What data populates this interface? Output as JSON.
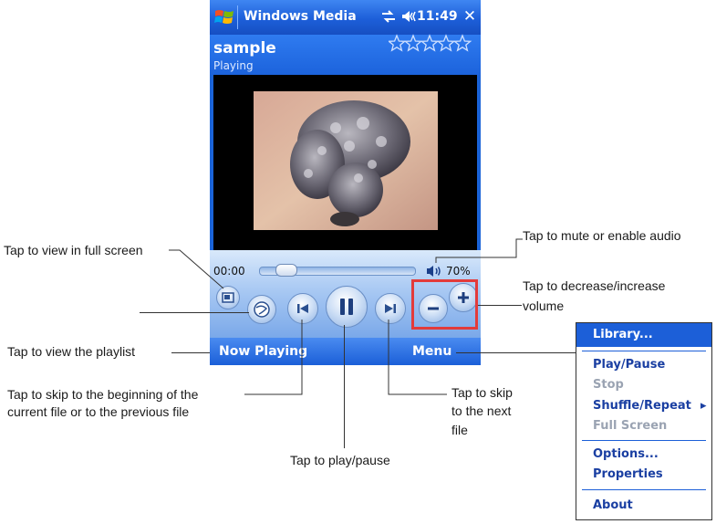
{
  "titlebar": {
    "app_title": "Windows Media",
    "clock": "11:49",
    "close": "✕"
  },
  "track": {
    "title": "sample",
    "status": "Playing",
    "rating": "☆☆☆☆☆"
  },
  "playback": {
    "elapsed": "00:00",
    "progress": 0.05,
    "volume": "70%"
  },
  "menubar": {
    "now_playing": "Now Playing",
    "menu": "Menu"
  },
  "annotations": {
    "fullscreen": "Tap to view in full screen",
    "mute": "Tap to mute or enable audio",
    "volume_1": "Tap to decrease/increase",
    "volume_2": "volume",
    "playlist": "Tap to view the playlist",
    "skip_prev_1": "Tap to skip to the beginning of the",
    "skip_prev_2": "current file or to the previous file",
    "skip_next_1": "Tap to skip",
    "skip_next_2": "to the next",
    "skip_next_3": "file",
    "play_pause": "Tap to play/pause"
  },
  "context_menu": {
    "header": "Library...",
    "items": [
      {
        "label": "Play/Pause",
        "enabled": true
      },
      {
        "label": "Stop",
        "enabled": false
      },
      {
        "label": "Shuffle/Repeat",
        "enabled": true,
        "submenu": "▸"
      },
      {
        "label": "Full Screen",
        "enabled": false
      },
      {
        "label": "Options...",
        "enabled": true
      },
      {
        "label": "Properties",
        "enabled": true
      },
      {
        "label": "About",
        "enabled": true
      }
    ]
  },
  "icons": {
    "start": "windows-flag-icon",
    "sync": "connectivity-icon",
    "speaker": "speaker-icon",
    "close": "close-icon",
    "fullscreen": "fullscreen-icon",
    "playlist": "playlist-globe-icon",
    "prev": "skip-previous-icon",
    "play": "pause-icon",
    "next": "skip-next-icon",
    "voldown": "minus-icon",
    "volup": "plus-icon"
  },
  "colors": {
    "title_bar": "#1d5fd9",
    "highlight_box": "#e33b3b",
    "menu_text": "#1a3fa2"
  }
}
